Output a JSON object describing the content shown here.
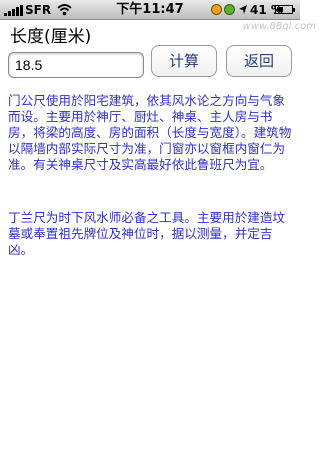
{
  "status_bar": {
    "carrier": "SFR",
    "time": "下午11:47",
    "battery_text": "41 %",
    "battery_level": 0.41
  },
  "form": {
    "length_label": "长度(厘米)",
    "input_value": "18.5",
    "calc_button": "计算",
    "back_button": "返回"
  },
  "watermark": "www.88ql.com",
  "paragraphs": [
    "门公尺使用於阳宅建筑，依其风水论之方向与气象而设。主要用於神厅、厨灶、神桌、主人房与书房，将梁的高度、房的面积（长度与宽度）。建筑物以隔墙内部实际尺寸为准，门窗亦以窗框内窗仁为准。有关神桌尺寸及实高最好依此鲁班尺为宜。",
    "丁兰尺为时下风水师必备之工具。主要用於建造坟墓或奉置祖先牌位及神位时，据以测量，并定吉凶。"
  ]
}
